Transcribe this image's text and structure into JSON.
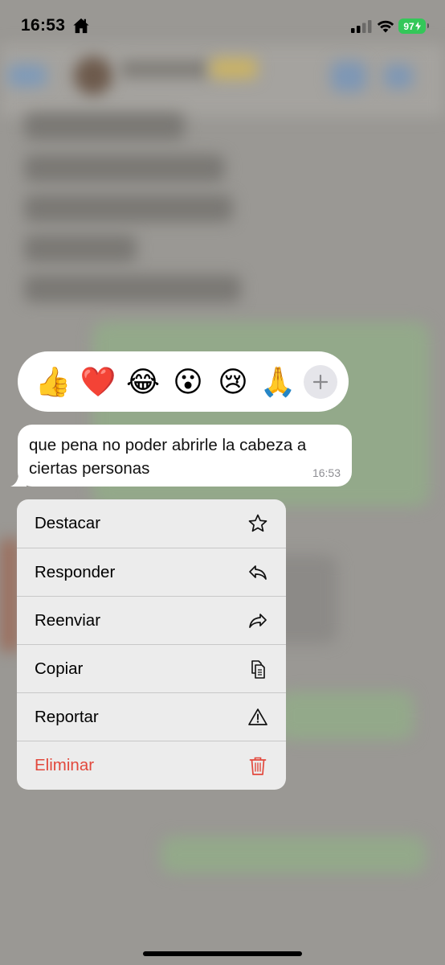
{
  "status_bar": {
    "time": "16:53",
    "battery": "97",
    "icons": [
      "home-icon",
      "signal-icon",
      "wifi-icon",
      "battery-icon"
    ]
  },
  "reactions": {
    "items": [
      "👍",
      "❤️",
      "😂",
      "😮",
      "😢",
      "🙏"
    ],
    "more_icon": "plus-icon"
  },
  "message": {
    "text": "que pena no poder abrirle la cabeza a ciertas personas",
    "time": "16:53"
  },
  "context_menu": {
    "items": [
      {
        "label": "Destacar",
        "icon": "star-icon"
      },
      {
        "label": "Responder",
        "icon": "reply-icon"
      },
      {
        "label": "Reenviar",
        "icon": "forward-icon"
      },
      {
        "label": "Copiar",
        "icon": "copy-icon"
      },
      {
        "label": "Reportar",
        "icon": "warning-icon"
      },
      {
        "label": "Eliminar",
        "icon": "trash-icon",
        "destructive": true
      }
    ]
  },
  "colors": {
    "destructive": "#e2483c",
    "battery": "#34c759",
    "menu_background": "#ececec"
  }
}
